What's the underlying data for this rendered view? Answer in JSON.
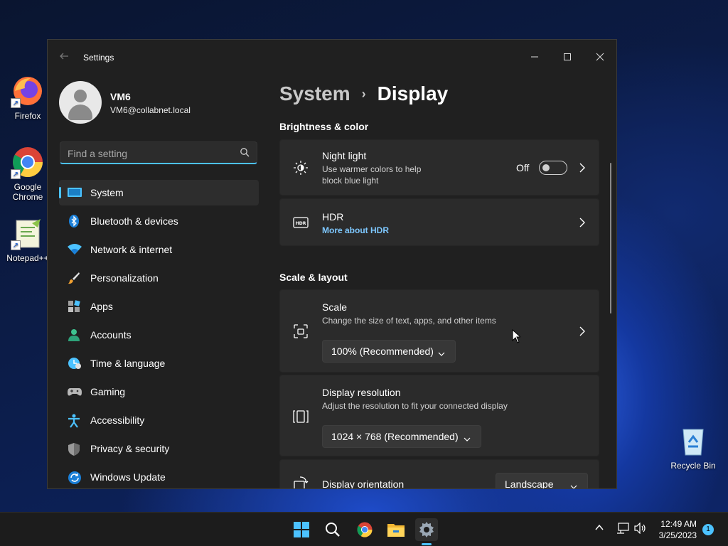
{
  "desktop": {
    "icons": [
      {
        "label": "Firefox",
        "icon": "firefox-icon"
      },
      {
        "label": "Google Chrome",
        "icon": "chrome-icon"
      },
      {
        "label": "Notepad++",
        "icon": "notepadpp-icon"
      },
      {
        "label": "Recycle Bin",
        "icon": "recycle-bin-icon"
      }
    ]
  },
  "window": {
    "title": "Settings",
    "controls": {
      "minimize": "—",
      "maximize": "☐",
      "close": "✕"
    }
  },
  "user": {
    "name": "VM6",
    "email": "VM6@collabnet.local"
  },
  "search": {
    "placeholder": "Find a setting",
    "value": ""
  },
  "sidebar": {
    "items": [
      {
        "label": "System",
        "icon": "system-icon",
        "active": true
      },
      {
        "label": "Bluetooth & devices",
        "icon": "bluetooth-icon"
      },
      {
        "label": "Network & internet",
        "icon": "wifi-icon"
      },
      {
        "label": "Personalization",
        "icon": "brush-icon"
      },
      {
        "label": "Apps",
        "icon": "apps-icon"
      },
      {
        "label": "Accounts",
        "icon": "accounts-icon"
      },
      {
        "label": "Time & language",
        "icon": "time-language-icon"
      },
      {
        "label": "Gaming",
        "icon": "gamepad-icon"
      },
      {
        "label": "Accessibility",
        "icon": "accessibility-icon"
      },
      {
        "label": "Privacy & security",
        "icon": "shield-icon"
      },
      {
        "label": "Windows Update",
        "icon": "update-icon"
      }
    ]
  },
  "breadcrumb": {
    "parent": "System",
    "separator": "›",
    "current": "Display"
  },
  "sections": {
    "brightness": {
      "title": "Brightness & color",
      "night_light": {
        "title": "Night light",
        "desc": "Use warmer colors to help block blue light",
        "state_label": "Off"
      },
      "hdr": {
        "title": "HDR",
        "link": "More about HDR",
        "badge": "HDR"
      }
    },
    "scale_layout": {
      "title": "Scale & layout",
      "scale": {
        "title": "Scale",
        "desc": "Change the size of text, apps, and other items",
        "value": "100% (Recommended)"
      },
      "resolution": {
        "title": "Display resolution",
        "desc": "Adjust the resolution to fit your connected display",
        "value": "1024 × 768 (Recommended)"
      },
      "orientation": {
        "title": "Display orientation",
        "value": "Landscape"
      }
    }
  },
  "taskbar": {
    "apps": [
      "start-icon",
      "search-icon",
      "chrome-icon",
      "file-explorer-icon",
      "settings-icon"
    ],
    "time": "12:49 AM",
    "date": "3/25/2023",
    "notifications": "1"
  },
  "colors": {
    "accent": "#4cc2ff",
    "window_bg": "#202020",
    "card_bg": "#2b2b2b"
  }
}
